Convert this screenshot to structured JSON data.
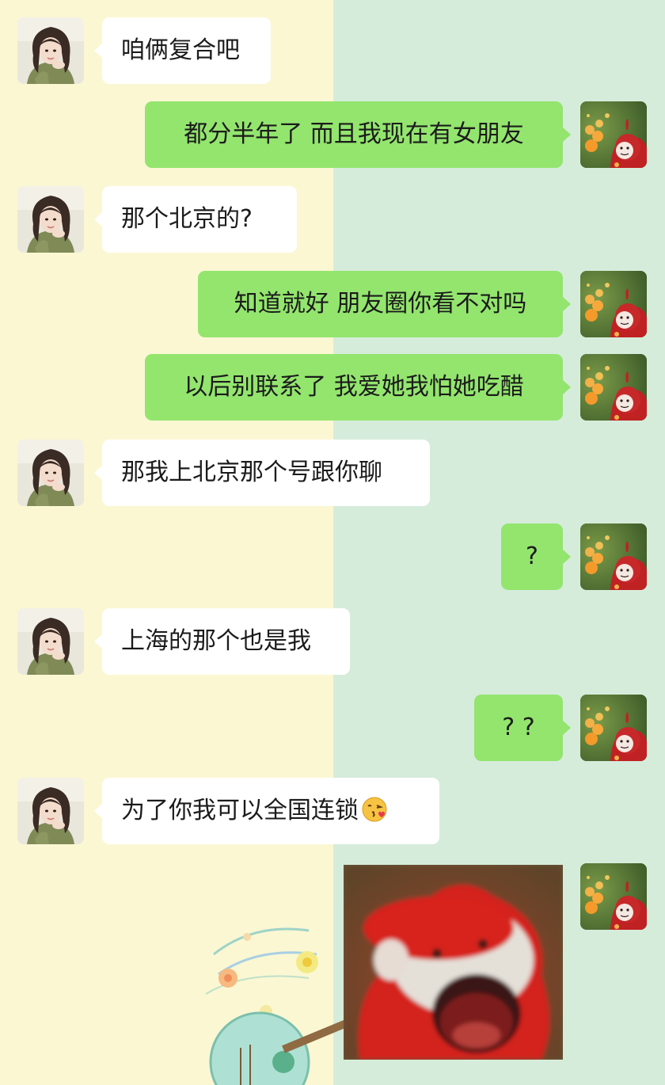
{
  "chat": {
    "messages": [
      {
        "side": "in",
        "text": "咱俩复合吧"
      },
      {
        "side": "out",
        "text": "都分半年了 而且我现在有女朋友"
      },
      {
        "side": "in",
        "text": "那个北京的?"
      },
      {
        "side": "out",
        "text": "知道就好 朋友圈你看不对吗"
      },
      {
        "side": "out",
        "text": "以后别联系了 我爱她我怕她吃醋"
      },
      {
        "side": "in",
        "text": "那我上北京那个号跟你聊"
      },
      {
        "side": "out",
        "text": "?"
      },
      {
        "side": "in",
        "text": "上海的那个也是我"
      },
      {
        "side": "out",
        "text": "? ?"
      },
      {
        "side": "in",
        "text": "为了你我可以全国连锁",
        "emoji": "kissing-face-with-heart-emoji"
      },
      {
        "side": "out",
        "type": "sticker",
        "sticker": "screaming-red-creature-sticker"
      }
    ]
  },
  "avatars": {
    "left": "girl-avatar",
    "right": "red-teletubby-avatar"
  },
  "colors": {
    "left_background": "#fbf7d3",
    "right_background": "#d6ecdb",
    "incoming_bubble": "#ffffff",
    "outgoing_bubble": "#93e56e",
    "text": "#1b1b1b"
  }
}
